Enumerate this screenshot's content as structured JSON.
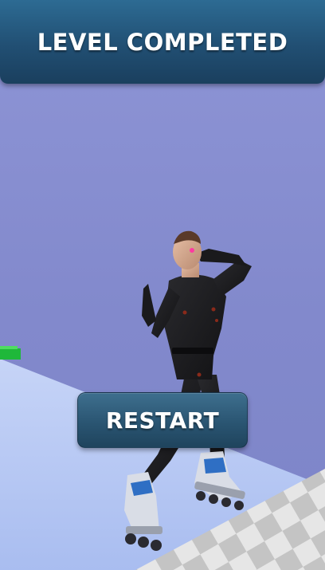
{
  "banner": {
    "title": "LEVEL COMPLETED"
  },
  "controls": {
    "restart_label": "RESTART"
  },
  "scene": {
    "background_color": "#8289cc",
    "floor_color": "#b7c8f5",
    "checker_light": "#e6e6e6",
    "checker_dark": "#c4c4c4",
    "obstacle_color": "#1fb83a",
    "character": "skater-character",
    "skate_accent": "#2f6fc4"
  }
}
